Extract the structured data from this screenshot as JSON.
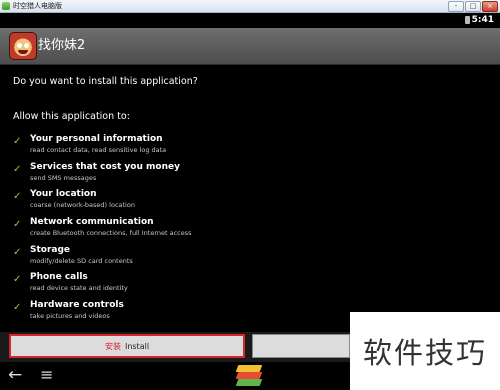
{
  "window": {
    "title": "时空猎人电脑版",
    "min_label": "-",
    "max_label": "□",
    "close_label": "×"
  },
  "status_bar": {
    "time": "5:41"
  },
  "header": {
    "app_name": "找你妹2"
  },
  "dialog": {
    "question": "Do you want to install this application?",
    "allow_heading": "Allow this application to:",
    "permissions": [
      {
        "title": "Your personal information",
        "desc": "read contact data, read sensitive log data"
      },
      {
        "title": "Services that cost you money",
        "desc": "send SMS messages"
      },
      {
        "title": "Your location",
        "desc": "coarse (network-based) location"
      },
      {
        "title": "Network communication",
        "desc": "create Bluetooth connections, full Internet access"
      },
      {
        "title": "Storage",
        "desc": "modify/delete SD card contents"
      },
      {
        "title": "Phone calls",
        "desc": "read device state and identity"
      },
      {
        "title": "Hardware controls",
        "desc": "take pictures and videos"
      }
    ],
    "check_glyph": "✓"
  },
  "buttons": {
    "install_cn": "安装",
    "install_en": "Install"
  },
  "nav": {
    "back_glyph": "←",
    "menu_glyph": "≡"
  },
  "watermark": {
    "text": "软件技巧"
  },
  "colors": {
    "accent_check": "#8fcf3a",
    "highlight_border": "#d9232d"
  }
}
